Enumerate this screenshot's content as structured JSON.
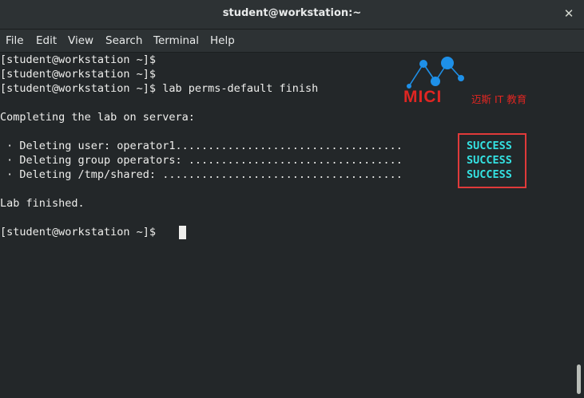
{
  "window": {
    "title": "student@workstation:~",
    "close_glyph": "✕"
  },
  "menu": {
    "items": [
      "File",
      "Edit",
      "View",
      "Search",
      "Terminal",
      "Help"
    ]
  },
  "terminal": {
    "lines": [
      "[student@workstation ~]$",
      "[student@workstation ~]$",
      "[student@workstation ~]$ lab perms-default finish",
      "",
      "Completing the lab on servera:",
      "",
      " · Deleting user: operator1...................................",
      " · Deleting group operators: .................................",
      " · Deleting /tmp/shared: .....................................",
      "",
      "Lab finished.",
      "",
      "[student@workstation ~]$"
    ],
    "status": [
      "SUCCESS",
      "SUCCESS",
      "SUCCESS"
    ]
  },
  "watermark": {
    "logo_text": "MICI",
    "logo_subtext": "迈斯 IT 教育"
  },
  "colors": {
    "background": "#232729",
    "text": "#eeeeec",
    "success": "#34e2e2",
    "highlight": "#e03a3a",
    "logo": "#e02622"
  }
}
